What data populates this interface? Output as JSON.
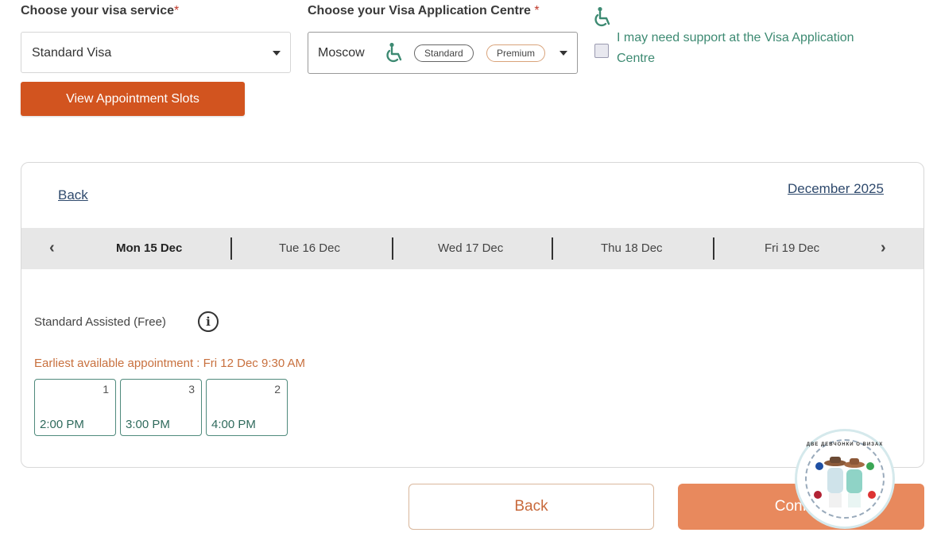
{
  "form": {
    "visa_service_label": "Choose your visa service",
    "visa_service_value": "Standard Visa",
    "centre_label": "Choose your Visa Application Centre ",
    "required_mark": "*",
    "centre_value": "Moscow",
    "standard_pill": "Standard",
    "premium_pill": "Premium",
    "support_text_line1": "I may need support at the Visa Application",
    "support_text_line2": "Centre",
    "view_slots_button": "View Appointment Slots"
  },
  "calendar": {
    "back_link": "Back",
    "month_link": "December 2025",
    "days": [
      "Mon 15 Dec",
      "Tue 16 Dec",
      "Wed 17 Dec",
      "Thu 18 Dec",
      "Fri 19 Dec"
    ],
    "prev_arrow": "‹",
    "next_arrow": "›",
    "service_type": "Standard Assisted (Free)",
    "earliest": "Earliest available appointment : Fri 12 Dec 9:30 AM",
    "slots": [
      {
        "count": "1",
        "time": "2:00 PM"
      },
      {
        "count": "3",
        "time": "3:00 PM"
      },
      {
        "count": "2",
        "time": "4:00 PM"
      }
    ]
  },
  "footer": {
    "back_button": "Back",
    "confirm_button": "Confirm"
  },
  "watermark": {
    "text": "ДВЕ ДЕВЧОНКИ О ВИЗАХ"
  },
  "colors": {
    "accent": "#d2541f",
    "confirm": "#e8895d",
    "support_green": "#3d8a72"
  },
  "icons": [
    "wheelchair-icon",
    "chevron-down-icon",
    "chevron-left-icon",
    "chevron-right-icon",
    "info-icon"
  ]
}
